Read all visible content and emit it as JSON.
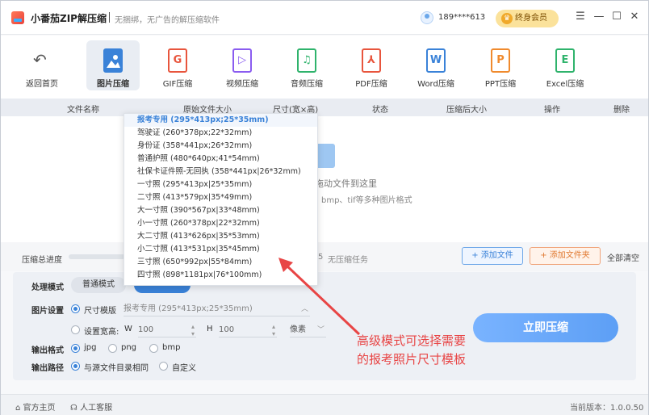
{
  "titlebar": {
    "app_name": "小番茄ZIP解压缩",
    "tagline": "无捆绑，无广告的解压缩软件",
    "phone": "189****613",
    "vip_label": "终身会员",
    "vip_icon": "crown-icon"
  },
  "toolbar": {
    "back": "返回首页",
    "items": [
      {
        "label": "图片压缩",
        "icon": "image-icon",
        "color": "#3a82d8"
      },
      {
        "label": "GIF压缩",
        "icon": "G",
        "color": "#e8553d"
      },
      {
        "label": "视频压缩",
        "icon": "▷",
        "color": "#8a5cf0"
      },
      {
        "label": "音频压缩",
        "icon": "♫",
        "color": "#2fb36c"
      },
      {
        "label": "PDF压缩",
        "icon": "⅄",
        "color": "#e8553d"
      },
      {
        "label": "Word压缩",
        "icon": "W",
        "color": "#3a82d8"
      },
      {
        "label": "PPT压缩",
        "icon": "P",
        "color": "#f08a2d"
      },
      {
        "label": "Excel压缩",
        "icon": "E",
        "color": "#2fb36c"
      }
    ]
  },
  "table_header": {
    "name": "文件名称",
    "size": "原始文件大小",
    "dim": "尺寸(宽×高)",
    "status": "状态",
    "after": "压缩后大小",
    "op": "操作",
    "del": "删除"
  },
  "content": {
    "drop_text": "拖动文件到这里",
    "formats_text": "bmp、tif等多种图片格式"
  },
  "progress": {
    "label": "压缩总进度",
    "count": "5",
    "none_text": "无压缩任务",
    "add_file": "+ 添加文件",
    "add_folder": "+ 添加文件夹",
    "clear_all": "全部清空"
  },
  "settings": {
    "mode_label": "处理模式",
    "mode_normal": "普通模式",
    "image_label": "图片设置",
    "size_template": "尺寸模版",
    "template_value": "报考专用 (295*413px;25*35mm)",
    "set_wh": "设置宽高:",
    "w_label": "W",
    "w_value": "100",
    "h_label": "H",
    "h_value": "100",
    "unit": "像素",
    "format_label": "输出格式",
    "formats": [
      "jpg",
      "png",
      "bmp"
    ],
    "path_label": "输出路径",
    "path_same": "与源文件目录相同",
    "path_custom": "自定义",
    "go_button": "立即压缩"
  },
  "dropdown": {
    "items": [
      "报考专用 (295*413px;25*35mm)",
      "驾驶证 (260*378px;22*32mm)",
      "身份证 (358*441px;26*32mm)",
      "普通护照 (480*640px;41*54mm)",
      "社保卡证件照-无回执 (358*441px|26*32mm)",
      "一寸照  (295*413px|25*35mm)",
      "二寸照  (413*579px|35*49mm)",
      "大一寸照  (390*567px|33*48mm)",
      "小一寸照 (260*378px|22*32mm)",
      "大二寸照 (413*626px|35*53mm)",
      "小二寸照 (413*531px|35*45mm)",
      "三寸照 (650*992px|55*84mm)",
      "四寸照 (898*1181px|76*100mm)"
    ]
  },
  "annotation": {
    "line1": "高级模式可选择需要",
    "line2": "的报考照片尺寸模板"
  },
  "footer": {
    "home": "官方主页",
    "support": "人工客服",
    "version": "当前版本：1.0.0.50"
  }
}
